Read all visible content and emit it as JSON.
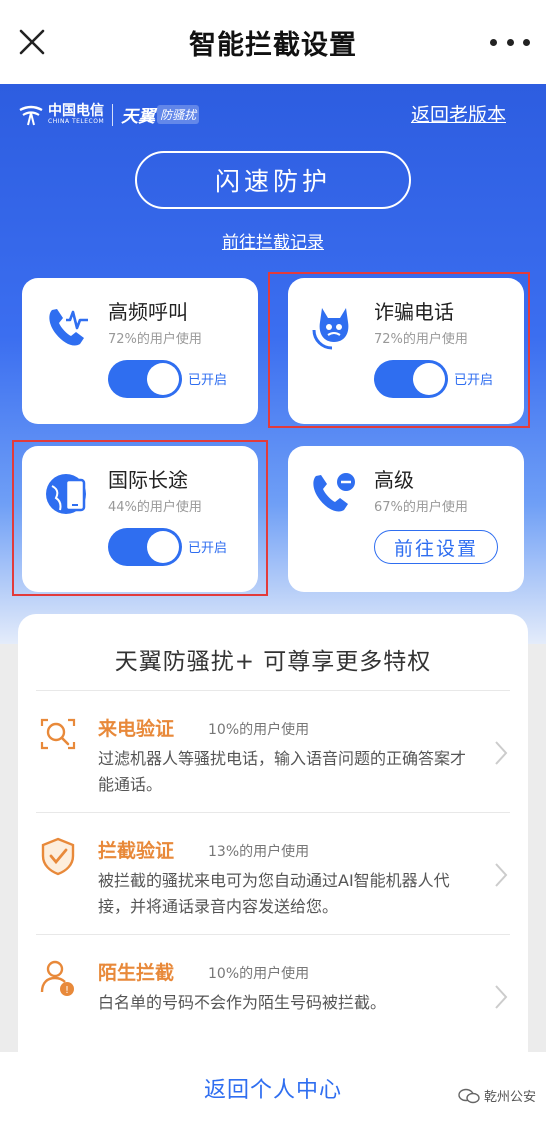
{
  "header": {
    "title": "智能拦截设置",
    "close_icon": "close-icon",
    "more_icon": "more-icon"
  },
  "brand": {
    "operator_cn": "中国电信",
    "operator_en": "CHINA TELECOM",
    "product": "天翼",
    "product_tag": "防骚扰"
  },
  "links": {
    "old_version": "返回老版本",
    "record": "前往拦截记录"
  },
  "flash_button": "闪速防护",
  "cards": [
    {
      "title": "高频呼叫",
      "usage": "72%的用户使用",
      "status": "已开启",
      "enabled": true,
      "icon": "frequent-call-icon"
    },
    {
      "title": "诈骗电话",
      "usage": "72%的用户使用",
      "status": "已开启",
      "enabled": true,
      "icon": "fraud-call-icon"
    },
    {
      "title": "国际长途",
      "usage": "44%的用户使用",
      "status": "已开启",
      "enabled": true,
      "icon": "international-call-icon"
    },
    {
      "title": "高级",
      "usage": "67%的用户使用",
      "button": "前往设置",
      "icon": "advanced-call-icon"
    }
  ],
  "panel": {
    "title": "天翼防骚扰+ 可尊享更多特权",
    "features": [
      {
        "name": "来电验证",
        "usage": "10%的用户使用",
        "desc": "过滤机器人等骚扰电话，输入语音问题的正确答案才能通话。",
        "icon": "verify-search-icon"
      },
      {
        "name": "拦截验证",
        "usage": "13%的用户使用",
        "desc": "被拦截的骚扰来电可为您自动通过AI智能机器人代接，并将通话录音内容发送给您。",
        "icon": "shield-check-icon"
      },
      {
        "name": "陌生拦截",
        "usage": "10%的用户使用",
        "desc": "白名单的号码不会作为陌生号码被拦截。",
        "icon": "stranger-user-icon"
      }
    ]
  },
  "bottom": {
    "back": "返回个人中心"
  },
  "watermark": "乾州公安",
  "colors": {
    "accent": "#2f6ef0",
    "feature_orange": "#e8893a",
    "highlight_red": "#e23b3b"
  }
}
